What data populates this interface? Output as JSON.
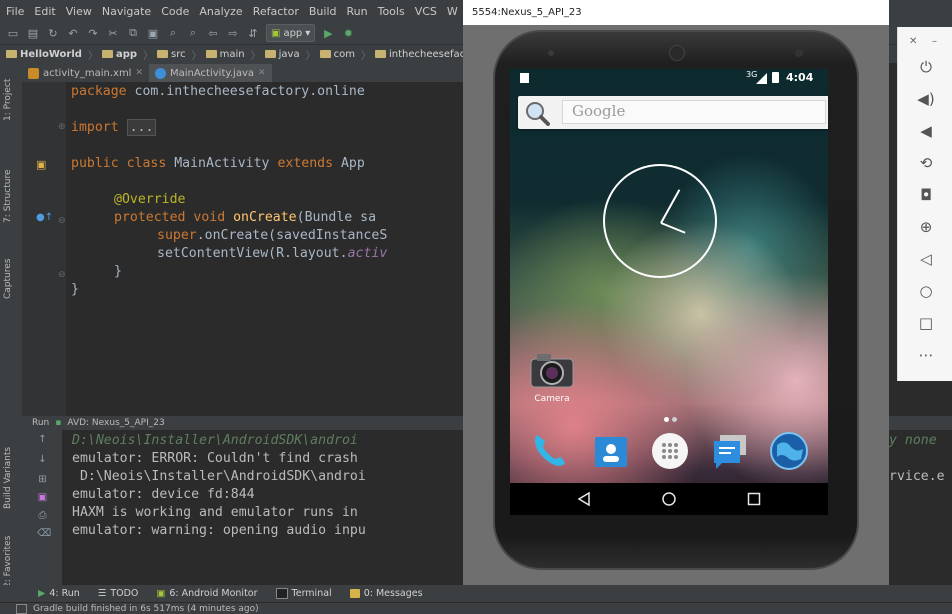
{
  "menu": [
    "File",
    "Edit",
    "View",
    "Navigate",
    "Code",
    "Analyze",
    "Refactor",
    "Build",
    "Run",
    "Tools",
    "VCS",
    "W"
  ],
  "toolbar": {
    "run_config": "app"
  },
  "breadcrumbs": [
    "HelloWorld",
    "app",
    "src",
    "main",
    "java",
    "com",
    "inthecheesefact"
  ],
  "left_tools": [
    "1: Project",
    "7: Structure",
    "Captures",
    "Build Variants",
    "2: Favorites"
  ],
  "editor_tabs": [
    {
      "label": "activity_main.xml"
    },
    {
      "label": "MainActivity.java"
    }
  ],
  "code": {
    "l1_kw": "package",
    "l1_rest": " com.inthecheesefactory.online",
    "l2_kw": "import",
    "l2_fold": "...",
    "l3_kw1": "public class",
    "l3_name": " MainActivity ",
    "l3_kw2": "extends",
    "l3_rest": " App",
    "l4_ann": "@Override",
    "l5_kw": "protected void",
    "l5_fn": " onCreate",
    "l5_rest": "(Bundle sa",
    "l6_kw": "super",
    "l6_rest": ".onCreate(savedInstanceS",
    "l7_rest": "setContentView(R.layout.",
    "l7_it": "activ",
    "l8": "}",
    "l9": "}"
  },
  "run_panel": {
    "title": "Run",
    "config": "AVD: Nexus_5_API_23",
    "lines": [
      "D:\\Neois\\Installer\\AndroidSDK\\androi",
      "emulator: ERROR: Couldn't find crash",
      " D:\\Neois\\Installer\\AndroidSDK\\androi",
      "emulator: device fd:844",
      "HAXM is working and emulator runs in",
      "emulator: warning: opening audio inpu"
    ],
    "right_tail_1": "y none",
    "right_tail_2": "rvice.e"
  },
  "bottom_tools": [
    "4: Run",
    "TODO",
    "6: Android Monitor",
    "Terminal",
    "0: Messages"
  ],
  "status": "Gradle build finished in 6s 517ms (4 minutes ago)",
  "emulator": {
    "title": "5554:Nexus_5_API_23",
    "time": "4:04",
    "signal": "3G",
    "search_placeholder": "Google",
    "camera_label": "Camera",
    "dock": [
      "phone-icon",
      "contacts-icon",
      "apps-icon",
      "messages-icon",
      "browser-icon"
    ],
    "nav": [
      "back-icon",
      "home-icon",
      "recents-icon"
    ]
  },
  "side_controls": [
    "power",
    "volume-up",
    "volume-down",
    "rotate",
    "screenshot",
    "zoom",
    "back",
    "home",
    "overview",
    "more"
  ],
  "colors": {
    "ide_bg": "#2b2b2b",
    "panel": "#3c3f41",
    "keyword": "#cc7832",
    "annotation": "#bbb529",
    "function": "#ffc66d"
  }
}
